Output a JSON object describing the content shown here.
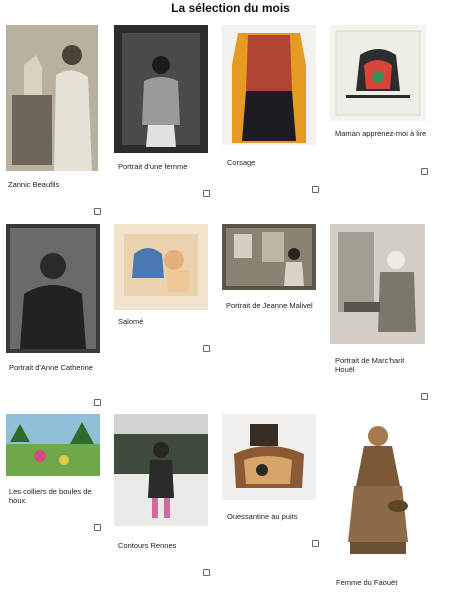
{
  "header": {
    "title": "La sélection du mois"
  },
  "items": [
    {
      "caption": "Zannic Beaufils"
    },
    {
      "caption": "Portrait d'une femme"
    },
    {
      "caption": "Corsage"
    },
    {
      "caption": "Maman apprenez-moi à lire"
    },
    {
      "caption": "Portrait d'Anne Catherine"
    },
    {
      "caption": "Salomé"
    },
    {
      "caption": "Portrait de Jeanne Malivel"
    },
    {
      "caption": "Portrait de Marc'harit Houël"
    },
    {
      "caption": "Les colliers de boules de houx"
    },
    {
      "caption": "Contours Rennes"
    },
    {
      "caption": "Ouessantine au puits"
    },
    {
      "caption": "Femme du Faouët"
    }
  ]
}
